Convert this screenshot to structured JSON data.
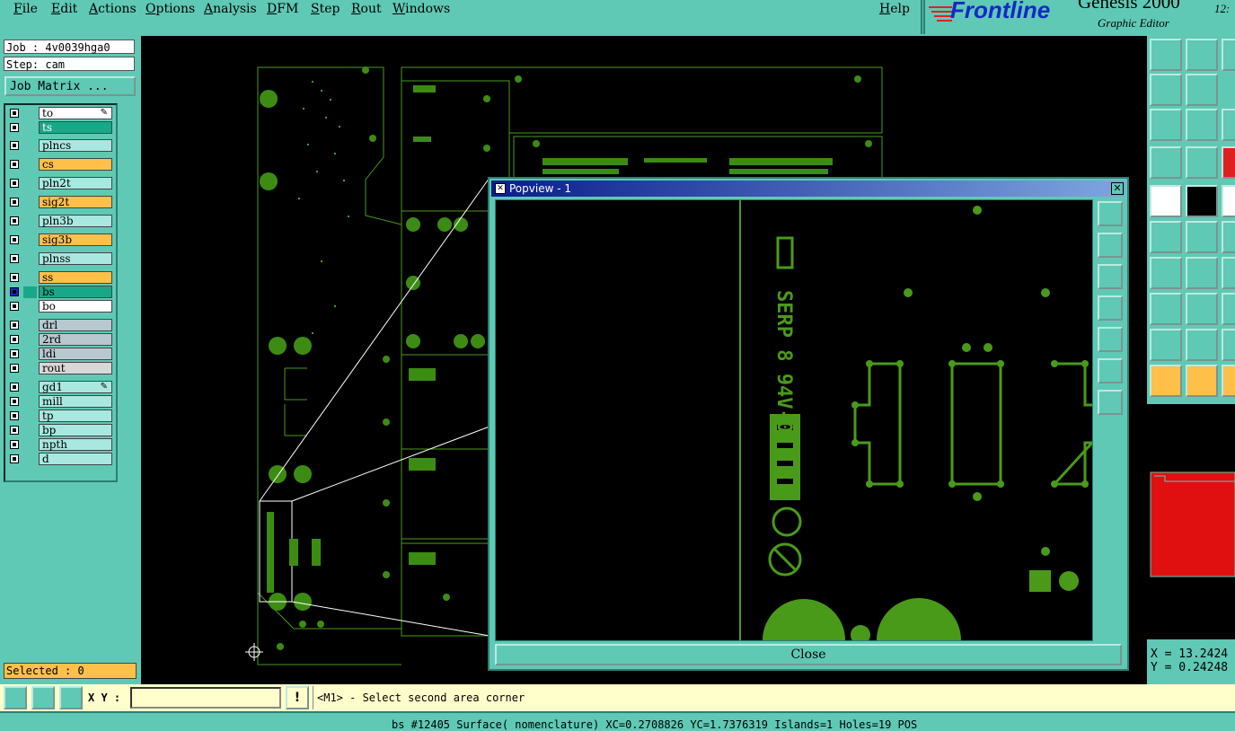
{
  "menubar": {
    "items": [
      "File",
      "Edit",
      "Actions",
      "Options",
      "Analysis",
      "DFM",
      "Step",
      "Rout",
      "Windows"
    ],
    "help": "Help"
  },
  "brand": {
    "logo": "Frontline",
    "product": "Genesis 2000",
    "subtitle": "Graphic Editor",
    "clock": "12:"
  },
  "job": {
    "job_label": "Job : 4v0039hga0",
    "step_label": "Step: cam",
    "matrix_button": "Job Matrix ..."
  },
  "layers": [
    {
      "name": "to",
      "color": "#ffffff",
      "marker": "pencil-icon"
    },
    {
      "name": "ts",
      "color": "#18a888"
    },
    {
      "name": "plncs",
      "color": "#a8e8e0"
    },
    {
      "name": "cs",
      "color": "#ffc04a"
    },
    {
      "name": "pln2t",
      "color": "#a8e8e0"
    },
    {
      "name": "sig2t",
      "color": "#ffc04a"
    },
    {
      "name": "pln3b",
      "color": "#a8e8e0"
    },
    {
      "name": "sig3b",
      "color": "#ffc04a"
    },
    {
      "name": "plnss",
      "color": "#a8e8e0"
    },
    {
      "name": "ss",
      "color": "#ffc04a"
    },
    {
      "name": "bs",
      "color": "#18a888",
      "active": true
    },
    {
      "name": "bo",
      "color": "#ffffff"
    },
    {
      "name": "drl",
      "color": "#b8c8d0"
    },
    {
      "name": "2rd",
      "color": "#b8c8d0"
    },
    {
      "name": "ldi",
      "color": "#b8c8d0"
    },
    {
      "name": "rout",
      "color": "#d8d8d8"
    },
    {
      "name": "gd1",
      "color": "#a8e8e0",
      "marker": "pencil-icon"
    },
    {
      "name": "mill",
      "color": "#a8e8e0"
    },
    {
      "name": "tp",
      "color": "#a8e8e0"
    },
    {
      "name": "bp",
      "color": "#a8e8e0"
    },
    {
      "name": "npth",
      "color": "#a8e8e0"
    },
    {
      "name": "d",
      "color": "#a8e8e0"
    }
  ],
  "selected": "Selected : 0",
  "popview": {
    "title": "Popview - 1",
    "close_label": "Close",
    "board_text": [
      "SERP 8 94V-0"
    ]
  },
  "coords": {
    "x": "X = 13.2424",
    "y": "Y = 0.24248"
  },
  "bottombar": {
    "xy_label": "X Y :",
    "xy_value": "",
    "alert_glyph": "!",
    "status": "<M1> - Select second area corner"
  },
  "infobar": {
    "text": "bs #12405 Surface( nomenclature) XC=0.2708826 YC=1.7376319 Islands=1 Holes=19 POS"
  },
  "colors": {
    "trace": "#4a9a1a",
    "pad": "#3c8c14",
    "panel": "#5fc9b5",
    "accent": "#ffc04a"
  }
}
